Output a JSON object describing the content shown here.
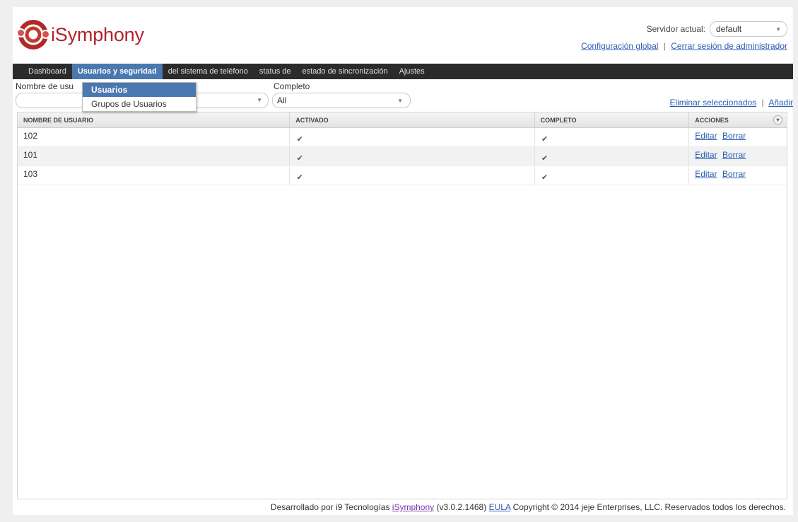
{
  "app": {
    "brand": "iSymphony"
  },
  "header": {
    "server_label": "Servidor actual:",
    "server_value": "default",
    "global_config_link": "Configuración global",
    "logout_link": "Cerrar sesión de administrador",
    "separator": "|"
  },
  "nav": {
    "items": [
      {
        "label": "Dashboard"
      },
      {
        "label": "Usuarios y seguridad"
      },
      {
        "label": "del sistema de teléfono"
      },
      {
        "label": "status de"
      },
      {
        "label": "estado de sincronización"
      },
      {
        "label": "Ajustes"
      }
    ],
    "active_index": 1
  },
  "dropdown": {
    "items": [
      {
        "label": "Usuarios"
      },
      {
        "label": "Grupos de Usuarios"
      }
    ],
    "selected_index": 0
  },
  "filters": {
    "user_label": "Nombre de usu",
    "user_value": "",
    "complete_label": "Completo",
    "complete_value": "All"
  },
  "actions": {
    "delete_selected": "Eliminar seleccionados",
    "add": "Añadir",
    "separator": "|"
  },
  "table": {
    "columns": [
      "NOMBRE DE USUARIO",
      "ACTIVADO",
      "COMPLETO",
      "ACCIONES"
    ],
    "rows": [
      {
        "name": "102",
        "enabled": true,
        "complete": true,
        "edit": "Editar",
        "delete": "Borrar"
      },
      {
        "name": "101",
        "enabled": true,
        "complete": true,
        "edit": "Editar",
        "delete": "Borrar"
      },
      {
        "name": "103",
        "enabled": true,
        "complete": true,
        "edit": "Editar",
        "delete": "Borrar"
      }
    ]
  },
  "footer": {
    "prefix": "Desarrollado por i9 Tecnologías",
    "product_link": "iSymphony",
    "version": "(v3.0.2.1468)",
    "eula_link": "EULA",
    "copyright": "Copyright © 2014 jeje Enterprises, LLC. Reservados todos los derechos."
  },
  "colors": {
    "brand_red": "#b3222a",
    "nav_bg": "#2b2b2b",
    "accent_blue": "#4a78b0",
    "link_blue": "#2a5db0"
  }
}
